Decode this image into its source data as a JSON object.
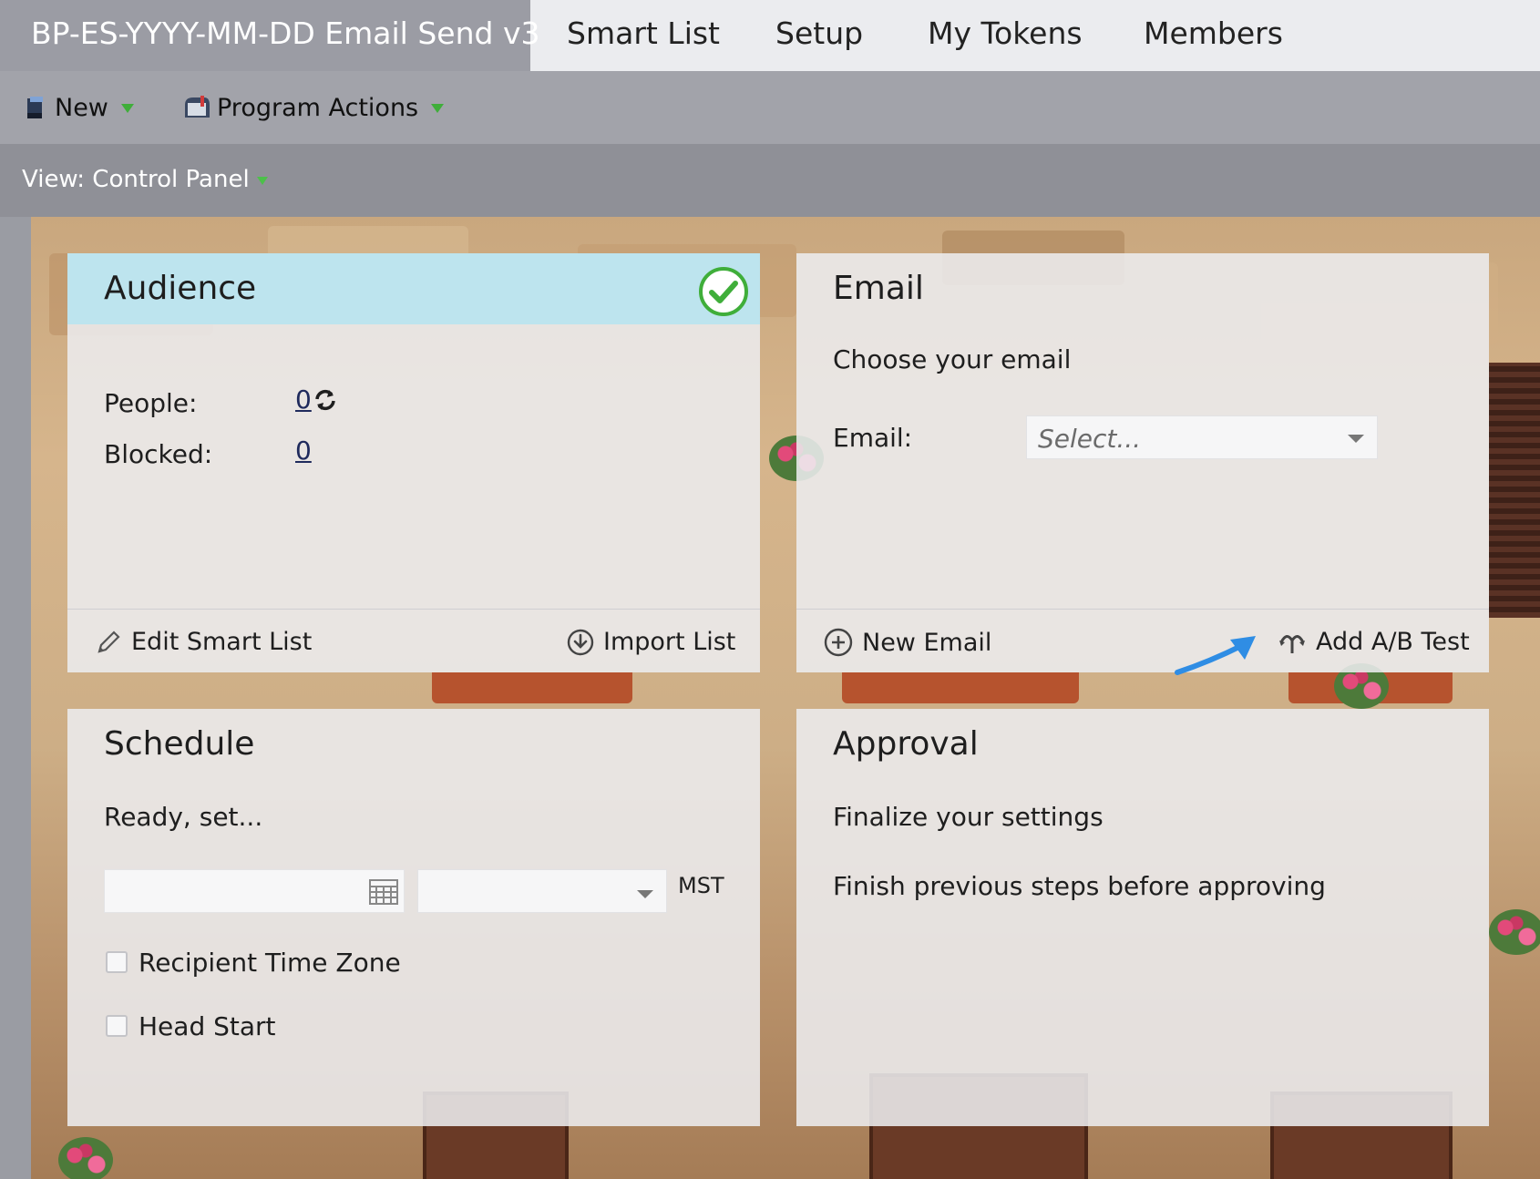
{
  "tabs": {
    "active": "BP-ES-YYYY-MM-DD Email Send v3",
    "items": [
      "Smart List",
      "Setup",
      "My Tokens",
      "Members"
    ]
  },
  "toolbar": {
    "new_label": "New",
    "program_actions_label": "Program Actions"
  },
  "view": {
    "label": "View: Control Panel"
  },
  "audience": {
    "title": "Audience",
    "people_label": "People:",
    "people_value": "0",
    "blocked_label": "Blocked:",
    "blocked_value": "0",
    "edit_smart_list": "Edit Smart List",
    "import_list": "Import List"
  },
  "email": {
    "title": "Email",
    "subtitle": "Choose your email",
    "email_label": "Email:",
    "select_placeholder": "Select...",
    "new_email": "New Email",
    "add_ab_test": "Add A/B Test"
  },
  "schedule": {
    "title": "Schedule",
    "subtitle": "Ready, set...",
    "timezone_abbr": "MST",
    "recipient_time_zone": "Recipient Time Zone",
    "head_start": "Head Start"
  },
  "approval": {
    "title": "Approval",
    "subtitle": "Finalize your settings",
    "message": "Finish previous steps before approving"
  },
  "colors": {
    "accent_green": "#3fae3a",
    "audience_header": "#bde4ee",
    "arrow_blue": "#2f8de4"
  }
}
